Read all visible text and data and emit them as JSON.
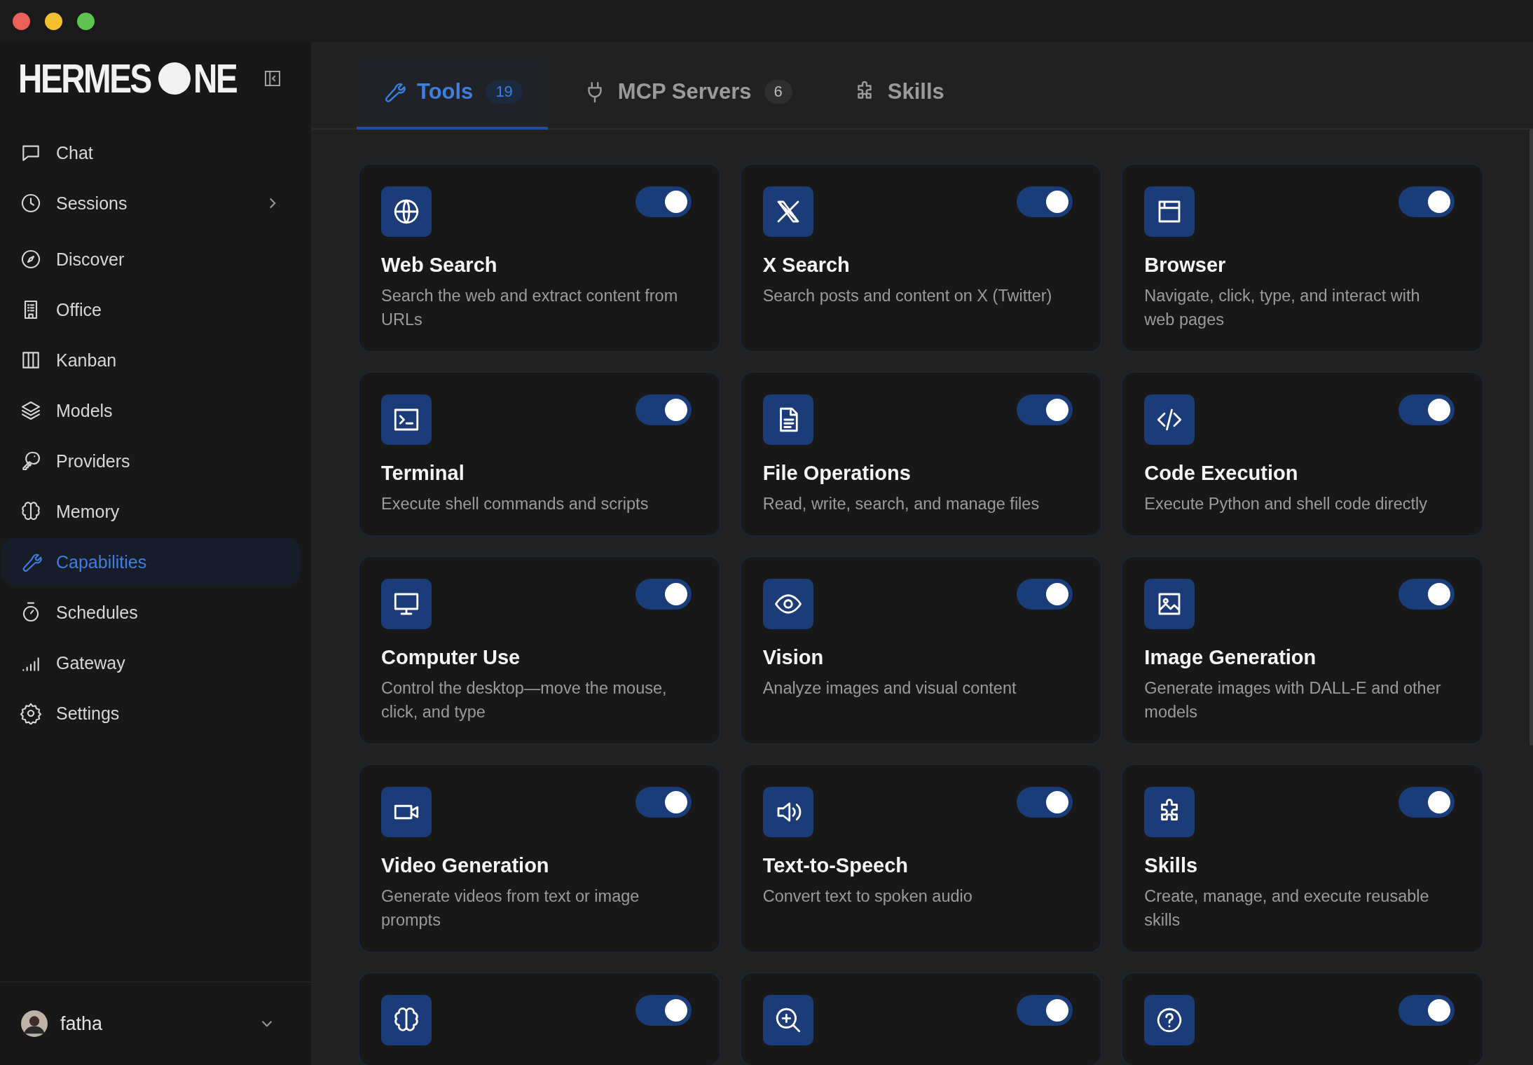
{
  "window": {
    "controls": [
      {
        "color": "#ec5f57"
      },
      {
        "color": "#f4c02f"
      },
      {
        "color": "#5ec44f"
      }
    ]
  },
  "sidebar": {
    "logo": {
      "left": "HERMES",
      "right": "NE"
    },
    "items": [
      {
        "label": "Chat",
        "selected": false
      },
      {
        "label": "Sessions",
        "selected": false,
        "kind": "expandable"
      },
      {
        "label": "Discover",
        "selected": false
      },
      {
        "label": "Office",
        "selected": false
      },
      {
        "label": "Kanban",
        "selected": false
      },
      {
        "label": "Models",
        "selected": false
      },
      {
        "label": "Providers",
        "selected": false
      },
      {
        "label": "Memory",
        "selected": false
      },
      {
        "label": "Capabilities",
        "selected": true
      },
      {
        "label": "Schedules",
        "selected": false
      },
      {
        "label": "Gateway",
        "selected": false
      },
      {
        "label": "Settings",
        "selected": false
      }
    ],
    "user": {
      "name": "fatha"
    }
  },
  "tabs": [
    {
      "label": "Tools",
      "count": "19",
      "selected": true
    },
    {
      "label": "MCP Servers",
      "count": "6",
      "selected": false
    },
    {
      "label": "Skills",
      "selected": false
    }
  ],
  "tools": [
    {
      "title": "Web Search",
      "description": "Search the web and extract content from URLs",
      "on": true
    },
    {
      "title": "X Search",
      "description": "Search posts and content on X (Twitter)",
      "on": true
    },
    {
      "title": "Browser",
      "description": "Navigate, click, type, and interact with web pages",
      "on": true
    },
    {
      "title": "Terminal",
      "description": "Execute shell commands and scripts",
      "on": true
    },
    {
      "title": "File Operations",
      "description": "Read, write, search, and manage files",
      "on": true
    },
    {
      "title": "Code Execution",
      "description": "Execute Python and shell code directly",
      "on": true
    },
    {
      "title": "Computer Use",
      "description": "Control the desktop—move the mouse, click, and type",
      "on": true
    },
    {
      "title": "Vision",
      "description": "Analyze images and visual content",
      "on": true
    },
    {
      "title": "Image Generation",
      "description": "Generate images with DALL-E and other models",
      "on": true
    },
    {
      "title": "Video Generation",
      "description": "Generate videos from text or image prompts",
      "on": true
    },
    {
      "title": "Text-to-Speech",
      "description": "Convert text to spoken audio",
      "on": true
    },
    {
      "title": "Skills",
      "description": "Create, manage, and execute reusable skills",
      "on": true
    },
    {
      "on": true
    },
    {
      "on": true
    },
    {
      "on": true
    }
  ]
}
